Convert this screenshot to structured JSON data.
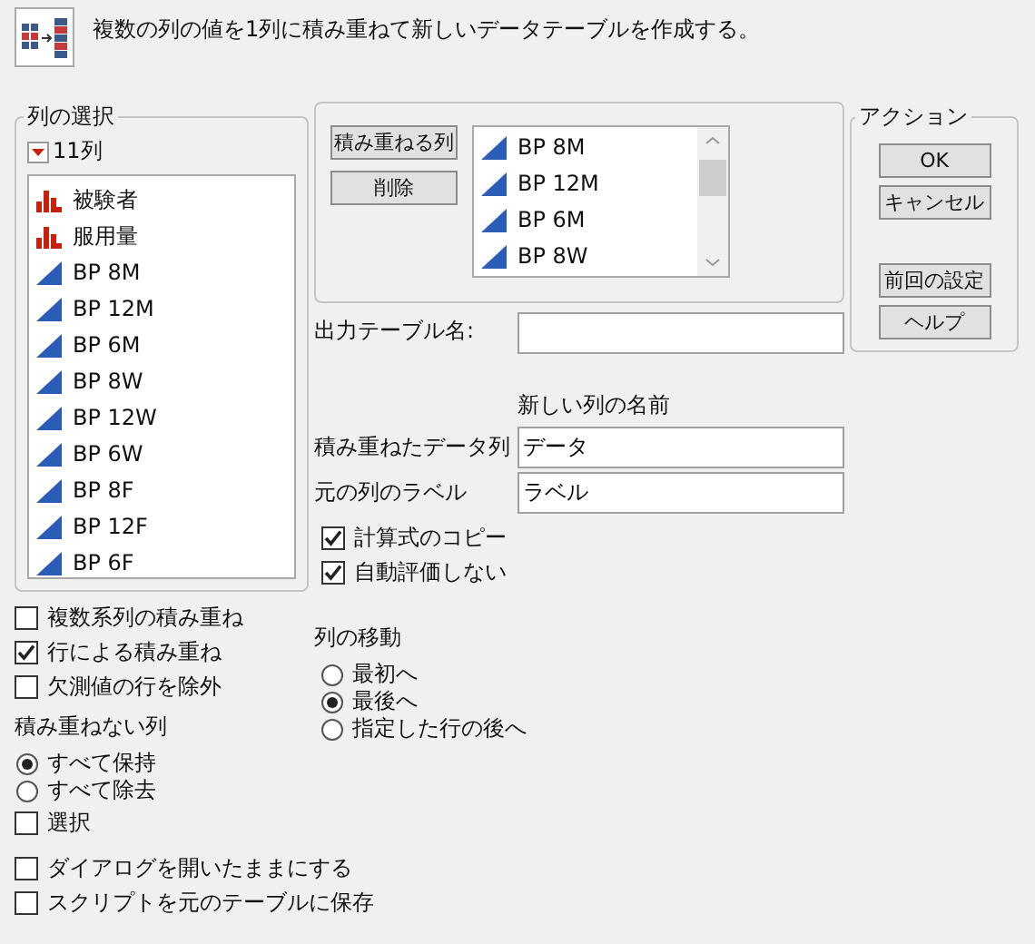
{
  "header": {
    "description": "複数の列の値を1列に積み重ねて新しいデータテーブルを作成する。"
  },
  "column_selection": {
    "title": "列の選択",
    "count": "11列",
    "columns": [
      {
        "name": "被験者",
        "kind": "nominal"
      },
      {
        "name": "服用量",
        "kind": "nominal"
      },
      {
        "name": "BP 8M",
        "kind": "continuous"
      },
      {
        "name": "BP 12M",
        "kind": "continuous"
      },
      {
        "name": "BP 6M",
        "kind": "continuous"
      },
      {
        "name": "BP 8W",
        "kind": "continuous"
      },
      {
        "name": "BP 12W",
        "kind": "continuous"
      },
      {
        "name": "BP 6W",
        "kind": "continuous"
      },
      {
        "name": "BP 8F",
        "kind": "continuous"
      },
      {
        "name": "BP 12F",
        "kind": "continuous"
      },
      {
        "name": "BP 6F",
        "kind": "continuous"
      }
    ]
  },
  "stack_panel": {
    "stack_button": "積み重ねる列",
    "remove_button": "削除",
    "columns": [
      {
        "name": "BP 8M",
        "kind": "continuous"
      },
      {
        "name": "BP 12M",
        "kind": "continuous"
      },
      {
        "name": "BP 6M",
        "kind": "continuous"
      },
      {
        "name": "BP 8W",
        "kind": "continuous"
      }
    ]
  },
  "output_table": {
    "label": "出力テーブル名:"
  },
  "new_column_names": {
    "heading": "新しい列の名前",
    "fields": [
      {
        "label": "積み重ねたデータ列",
        "value": "データ"
      },
      {
        "label": "元の列のラベル",
        "value": "ラベル"
      }
    ]
  },
  "formula_options": [
    {
      "label": "計算式のコピー",
      "checked": true
    },
    {
      "label": "自動評価しない",
      "checked": true
    }
  ],
  "actions": {
    "title": "アクション",
    "buttons": [
      "OK",
      "キャンセル"
    ],
    "secondary_buttons": [
      "前回の設定",
      "ヘルプ"
    ]
  },
  "stack_options": [
    {
      "label": "複数系列の積み重ね",
      "checked": false
    },
    {
      "label": "行による積み重ね",
      "checked": true
    },
    {
      "label": "欠測値の行を除外",
      "checked": false
    }
  ],
  "non_stacked": {
    "title": "積み重ねない列",
    "radios": [
      {
        "label": "すべて保持",
        "selected": true
      },
      {
        "label": "すべて除去",
        "selected": false
      }
    ],
    "select": {
      "label": "選択",
      "checked": false
    }
  },
  "move_columns": {
    "title": "列の移動",
    "radios": [
      {
        "label": "最初へ",
        "selected": false
      },
      {
        "label": "最後へ",
        "selected": true
      },
      {
        "label": "指定した行の後へ",
        "selected": false
      }
    ]
  },
  "dialog_options": [
    {
      "label": "ダイアログを開いたままにする",
      "checked": false
    },
    {
      "label": "スクリプトを元のテーブルに保存",
      "checked": false
    }
  ]
}
